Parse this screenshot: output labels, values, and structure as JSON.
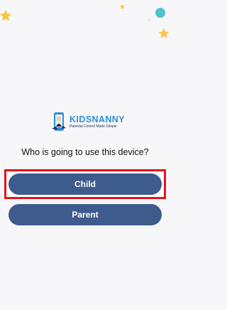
{
  "app": {
    "brand": "KIDSNANNY",
    "tagline": "Parental Control Made Simple"
  },
  "prompt": {
    "question": "Who is going to use this device?"
  },
  "buttons": {
    "child": "Child",
    "parent": "Parent"
  },
  "decorations": {
    "star_color": "#f6c544",
    "dot_color": "#4fc3c9",
    "highlight_color": "#e3141c",
    "button_color": "#3e5b8e",
    "brand_color": "#2f8fd8"
  }
}
